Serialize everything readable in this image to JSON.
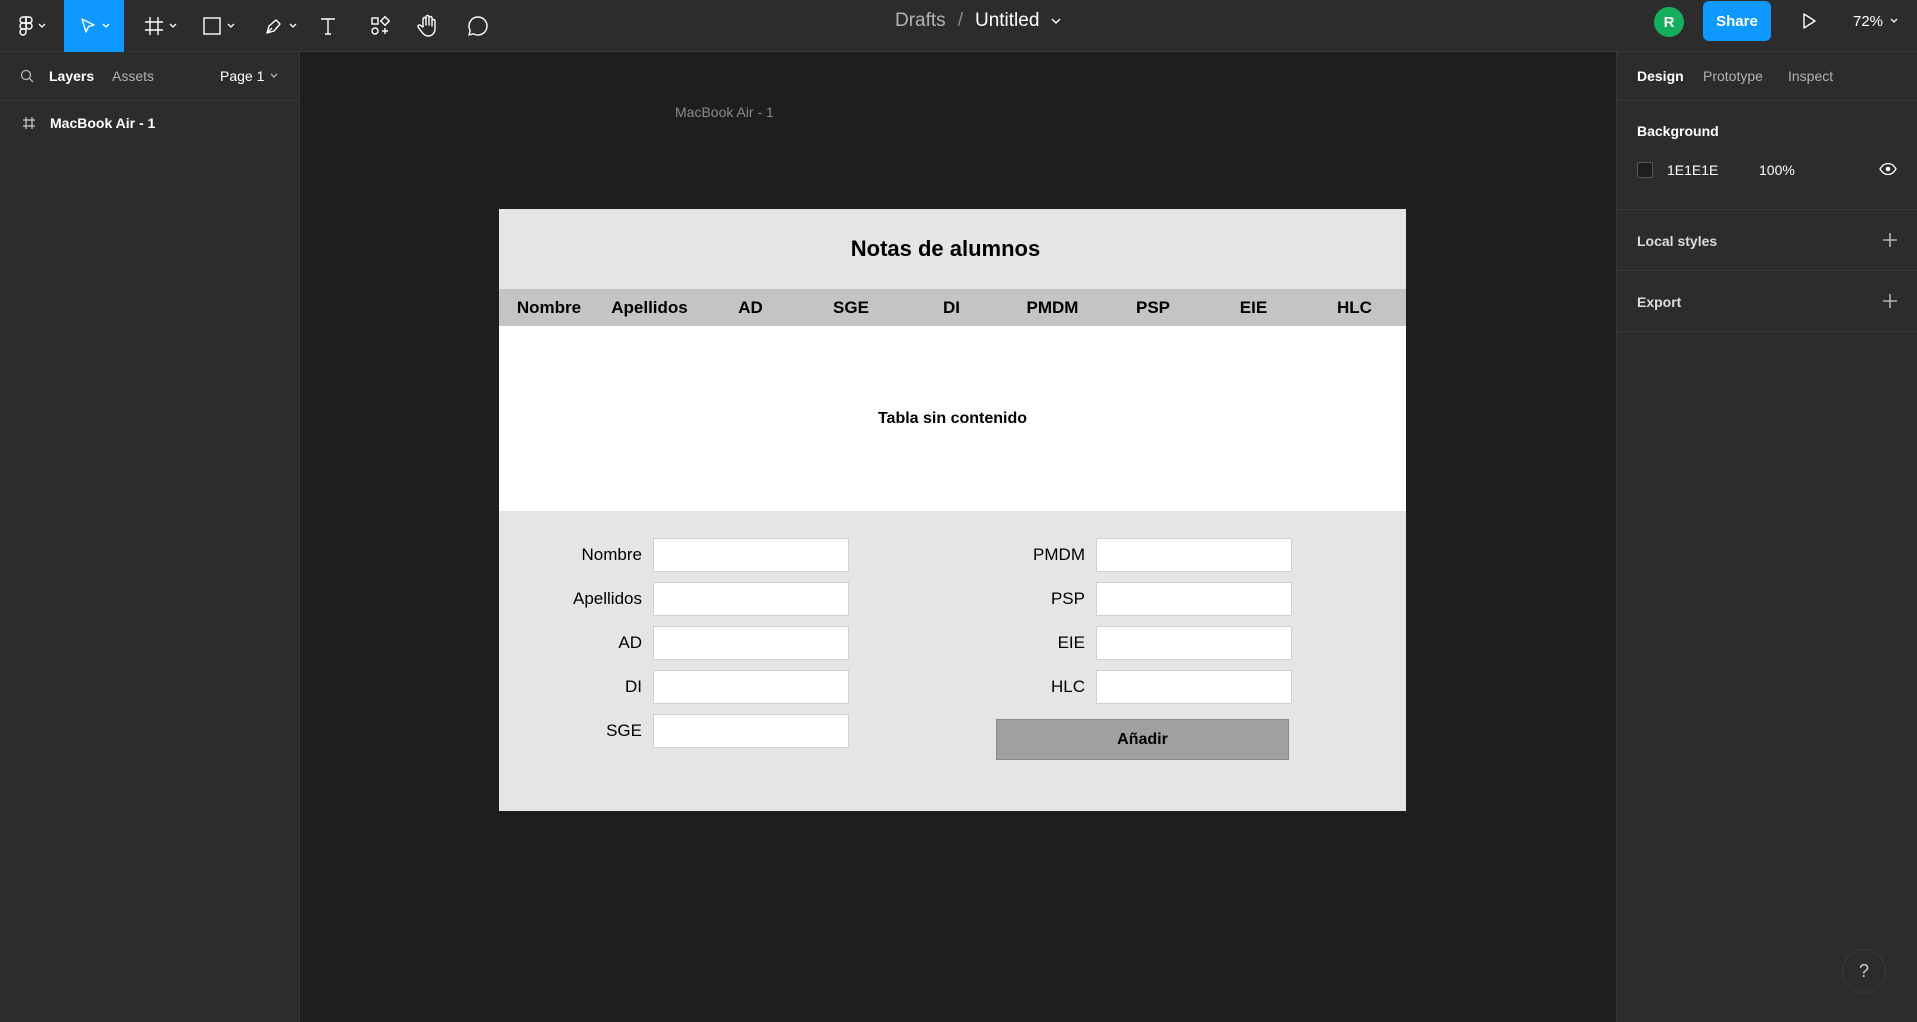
{
  "toolbar": {
    "breadcrumb": "Drafts",
    "separator": "/",
    "file_name": "Untitled",
    "avatar_initial": "R",
    "share_label": "Share",
    "zoom": "72%"
  },
  "left_panel": {
    "tab_layers": "Layers",
    "tab_assets": "Assets",
    "page": "Page 1",
    "layers": [
      "MacBook Air - 1"
    ]
  },
  "right_panel": {
    "tabs": [
      "Design",
      "Prototype",
      "Inspect"
    ],
    "background_title": "Background",
    "background_hex": "1E1E1E",
    "background_opacity": "100%",
    "local_styles": "Local styles",
    "export": "Export"
  },
  "canvas": {
    "frame_label": "MacBook Air - 1",
    "frame": {
      "title": "Notas de alumnos",
      "columns": [
        "Nombre",
        "Apellidos",
        "AD",
        "SGE",
        "DI",
        "PMDM",
        "PSP",
        "EIE",
        "HLC"
      ],
      "empty_message": "Tabla sin contenido",
      "form_left": [
        "Nombre",
        "Apellidos",
        "AD",
        "DI",
        "SGE"
      ],
      "form_right": [
        "PMDM",
        "PSP",
        "EIE",
        "HLC"
      ],
      "add_button": "Añadir"
    }
  },
  "help_label": "?",
  "colors": {
    "accent": "#0d99ff",
    "avatar": "#14ae5c",
    "panel": "#2c2c2c",
    "canvas": "#1e1e1e"
  }
}
